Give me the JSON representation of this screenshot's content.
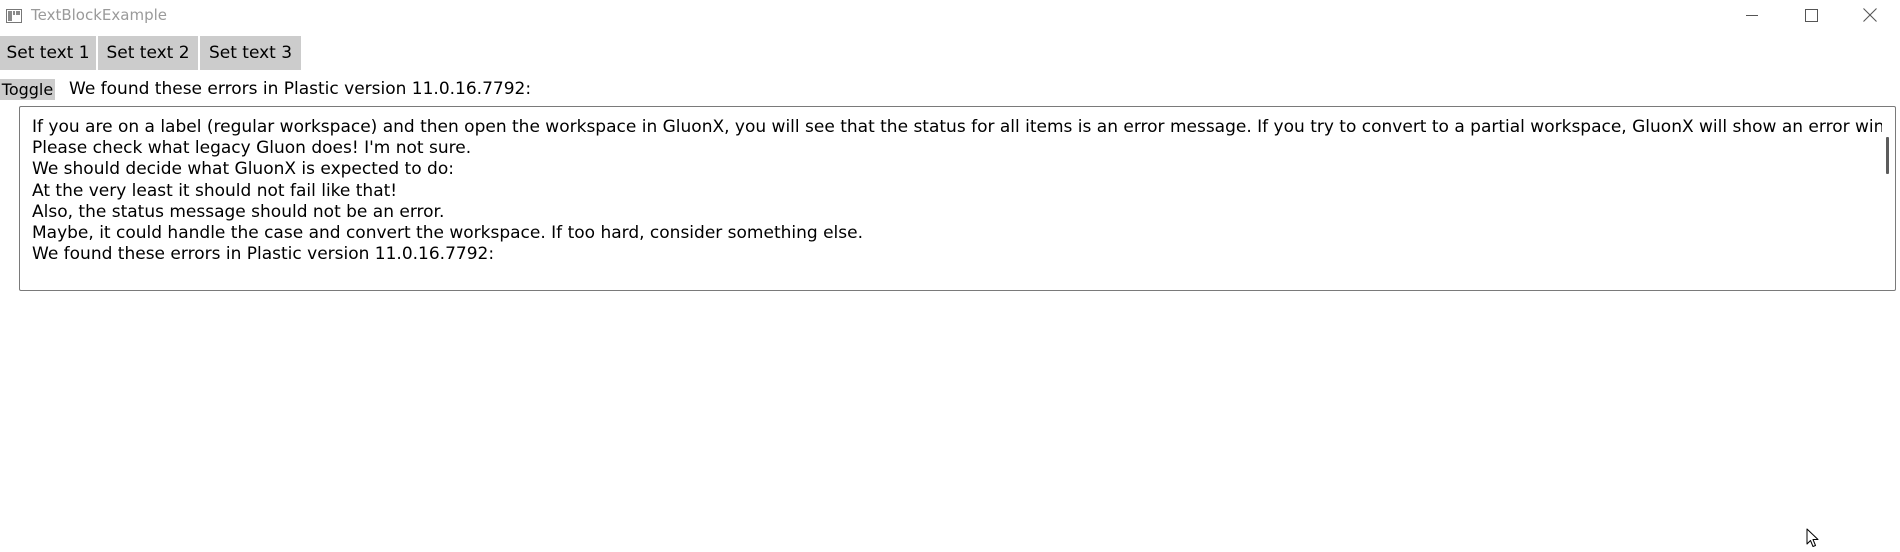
{
  "window": {
    "title": "TextBlockExample"
  },
  "toolbar": {
    "buttons": [
      {
        "label": "Set text 1"
      },
      {
        "label": "Set text 2"
      },
      {
        "label": "Set text 3"
      }
    ]
  },
  "toggle": {
    "label": "Toggle"
  },
  "header_text": "We found these errors in Plastic version 11.0.16.7792:",
  "text_box": {
    "lines": [
      "If you are on a label (regular workspace) and then open the workspace in GluonX, you will see that the status for all items is an error message. If you try to convert to a partial workspace, GluonX will show an error window. So:",
      "Please check what legacy Gluon does! I'm not sure.",
      "We should decide what GluonX is expected to do:",
      "At the very least it should not fail like that!",
      "Also, the status message should not be an error.",
      "Maybe, it could handle the case and convert the workspace. If too hard, consider something else.",
      "We found these errors in Plastic version 11.0.16.7792:"
    ]
  },
  "icons": {
    "app": "window-app-icon",
    "minimize": "minimize-icon",
    "maximize": "maximize-icon",
    "close": "close-icon",
    "cursor": "mouse-pointer-icon"
  }
}
